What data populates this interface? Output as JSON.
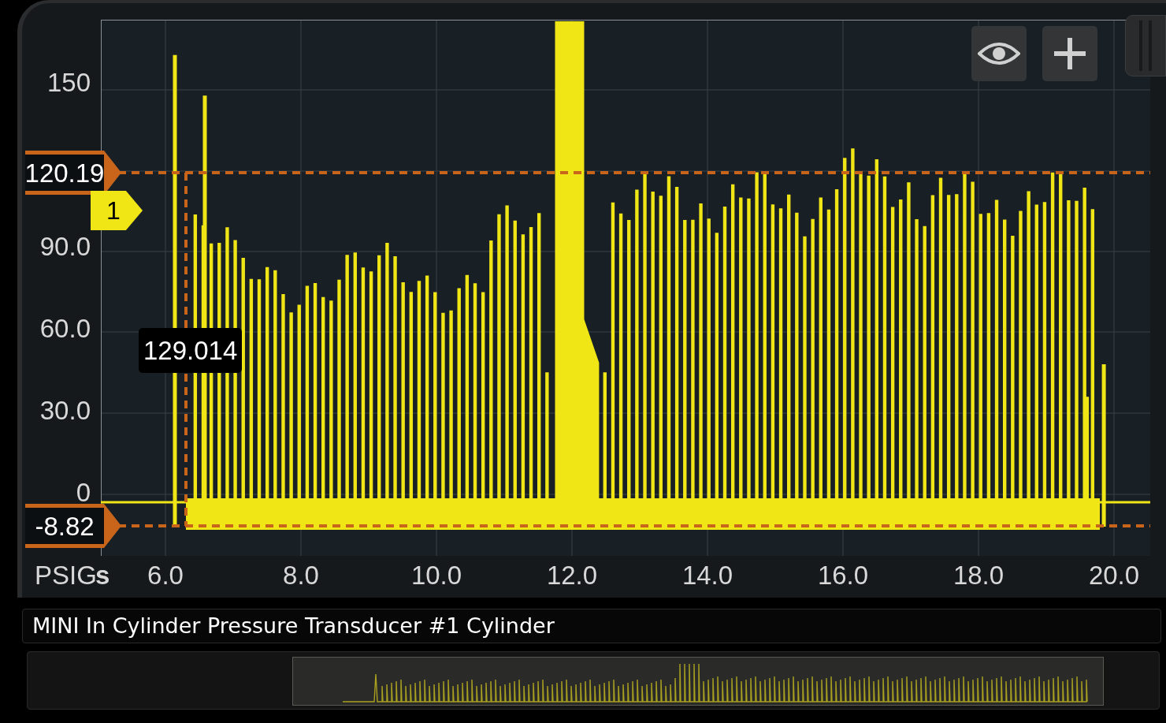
{
  "chart": {
    "y_ticks": [
      "150",
      "90.0",
      "60.0",
      "30.0",
      "0"
    ],
    "y_unit": "PSIG",
    "x_unit": "s",
    "x_ticks": [
      "6.0",
      "8.0",
      "10.0",
      "12.0",
      "14.0",
      "16.0",
      "18.0",
      "20.0"
    ]
  },
  "cursors": {
    "upper": "120.19",
    "lower": "-8.82",
    "marker": "1",
    "readout": "129.014"
  },
  "channel": {
    "title": "MINI In Cylinder Pressure Transducer #1 Cylinder"
  }
}
